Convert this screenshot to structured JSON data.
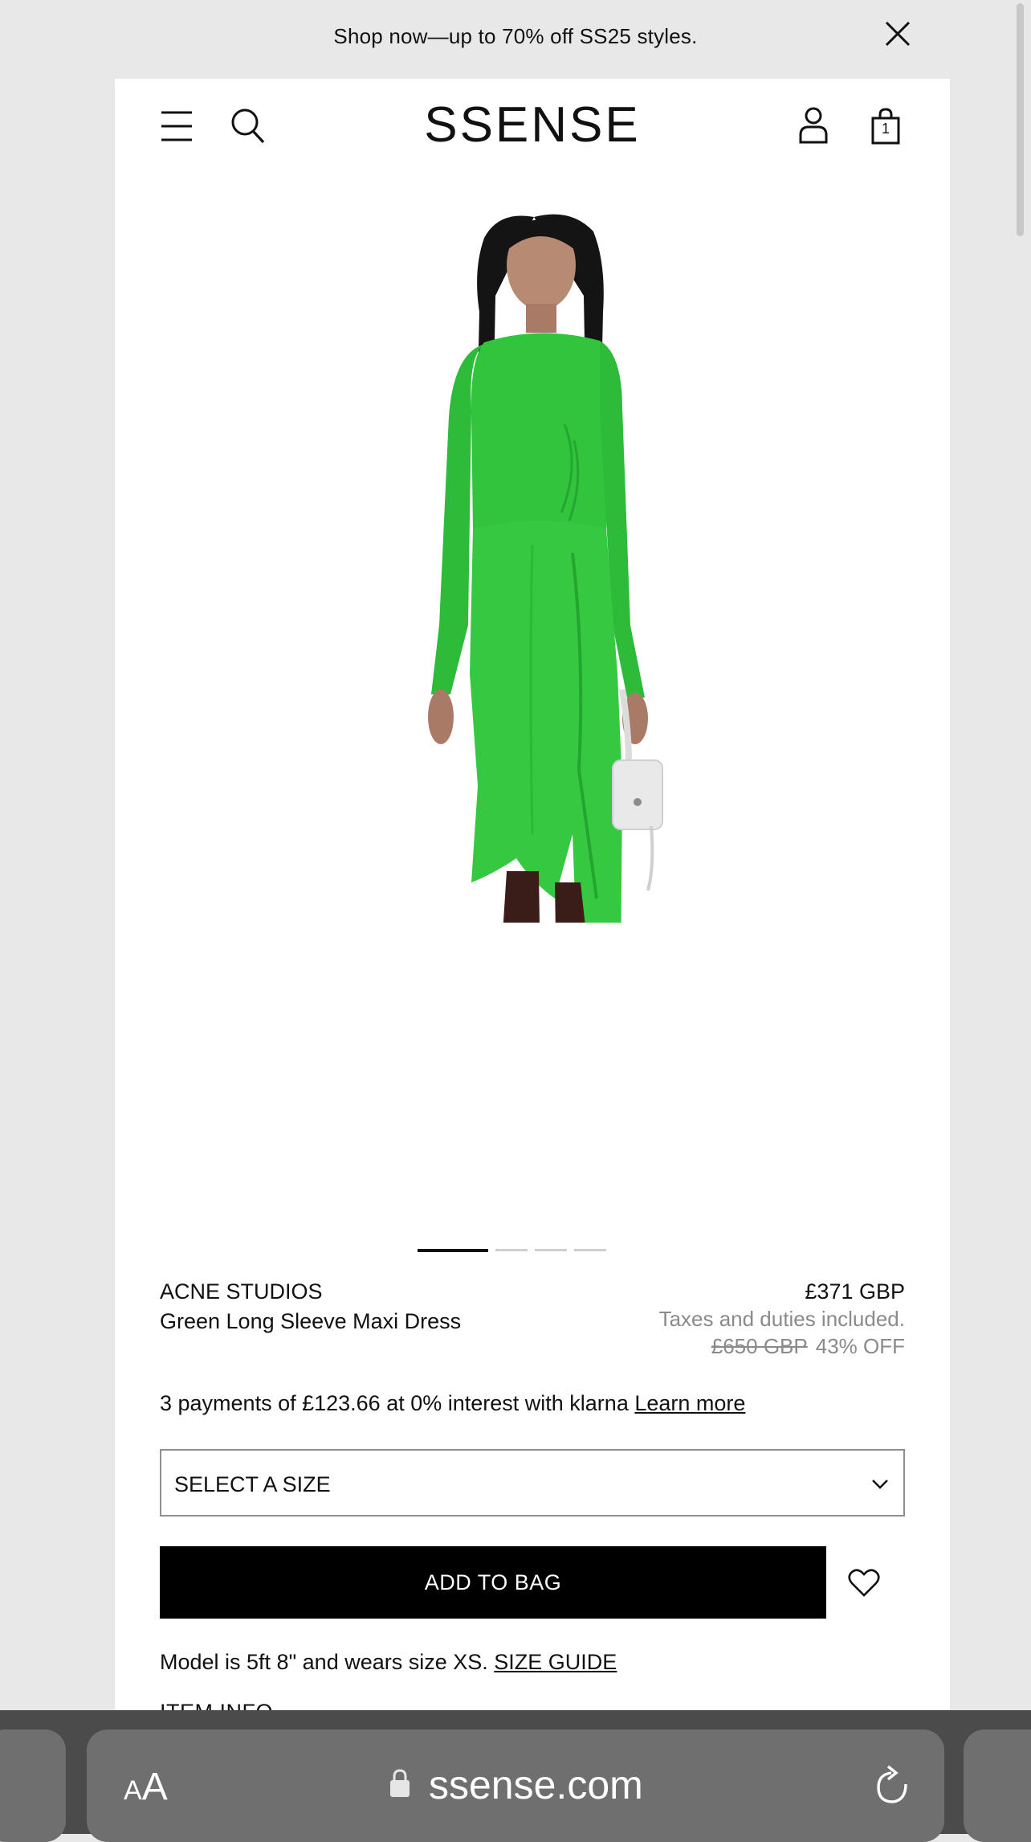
{
  "promo": {
    "text": "Shop now—up to 70% off SS25 styles."
  },
  "header": {
    "logo": "SSENSE",
    "bag_count": "1"
  },
  "product": {
    "brand": "ACNE STUDIOS",
    "name": "Green Long Sleeve Maxi Dress",
    "price": "£371 GBP",
    "tax_note": "Taxes and duties included.",
    "original_price": "£650 GBP",
    "discount": "43% OFF",
    "image_count": 4,
    "active_image_index": 0,
    "colors": {
      "dress": "#2fc63a",
      "boots": "#3a1c18",
      "bag": "#e9e9e9"
    }
  },
  "klarna": {
    "text": "3 payments of £123.66 at 0% interest with klarna",
    "link": "Learn more"
  },
  "size_select": {
    "label": "SELECT A SIZE"
  },
  "add_to_bag": {
    "label": "ADD TO BAG"
  },
  "model_info": {
    "text": "Model is 5ft 8\" and wears size XS.",
    "link": "SIZE GUIDE"
  },
  "item_info": {
    "label": "ITEM INFO"
  },
  "browser": {
    "aa_small": "A",
    "aa_big": "A",
    "url": "ssense.com"
  }
}
